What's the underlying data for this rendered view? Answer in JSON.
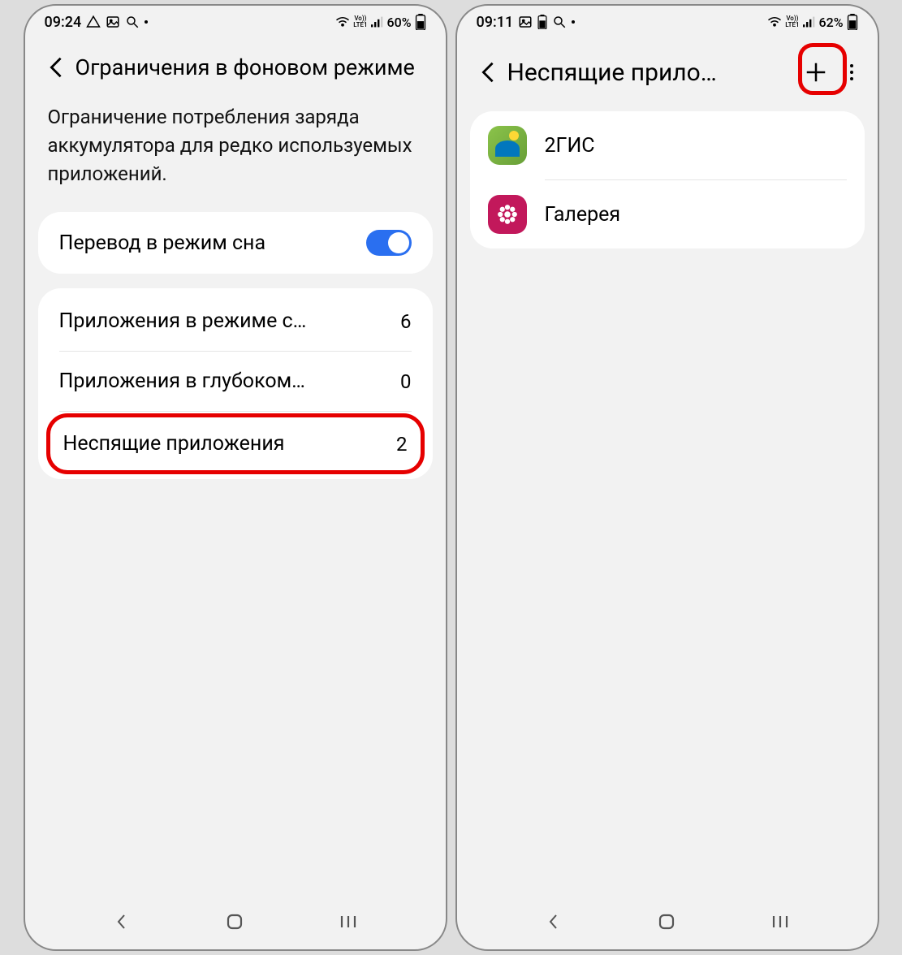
{
  "left": {
    "status": {
      "time": "09:24",
      "battery": "60%"
    },
    "header": {
      "title": "Ограничения в фоновом режиме"
    },
    "description": "Ограничение потребления заряда аккумулятора для редко используемых приложений.",
    "sleep_toggle": {
      "label": "Перевод в режим сна",
      "on": true
    },
    "list": {
      "items": [
        {
          "label": "Приложения в режиме с…",
          "count": "6"
        },
        {
          "label": "Приложения в глубоком…",
          "count": "0"
        },
        {
          "label": "Неспящие приложения",
          "count": "2"
        }
      ]
    }
  },
  "right": {
    "status": {
      "time": "09:11",
      "battery": "62%"
    },
    "header": {
      "title": "Неспящие прило…"
    },
    "apps": [
      {
        "name": "2ГИС"
      },
      {
        "name": "Галерея"
      }
    ]
  }
}
